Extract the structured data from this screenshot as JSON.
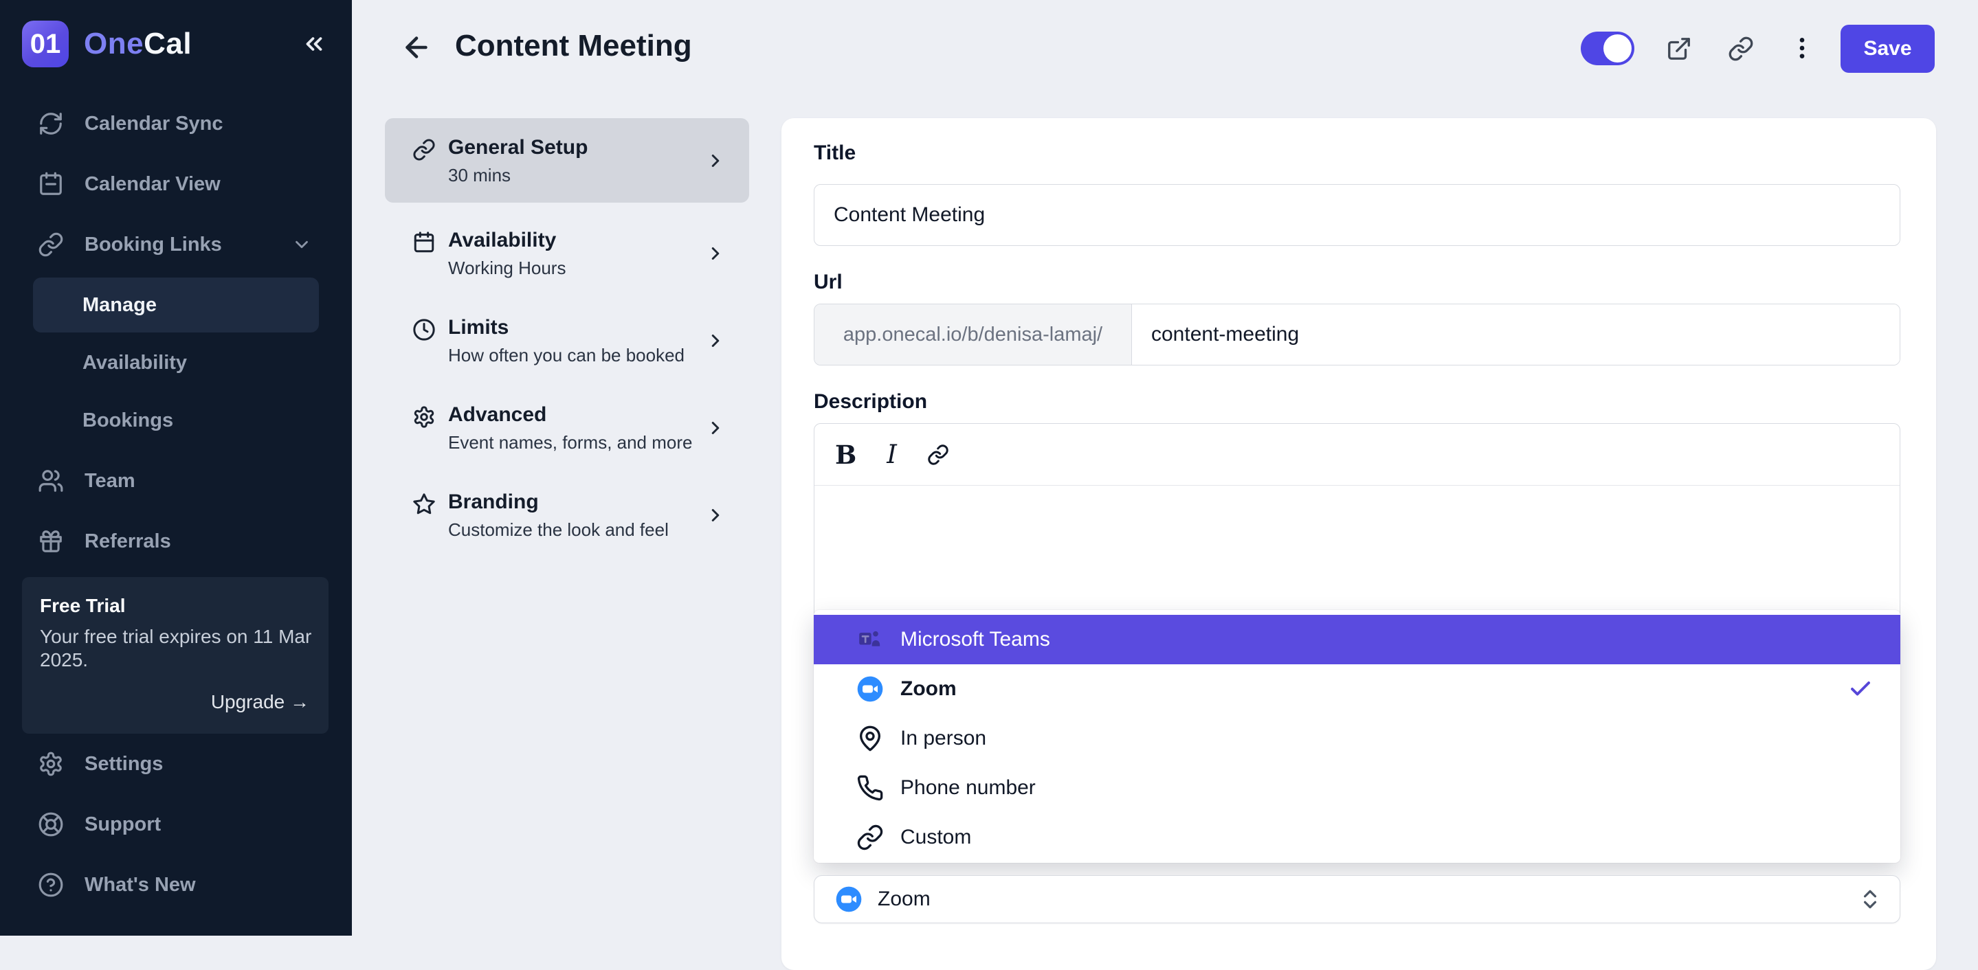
{
  "colors": {
    "accent": "#4f46e5",
    "highlight": "#5a4bdf",
    "zoom_blue": "#2d8cff",
    "sidebar_bg": "#0f1a2b"
  },
  "sidebar": {
    "brand": {
      "badge": "01",
      "name_primary": "One",
      "name_secondary": "Cal"
    },
    "items": [
      {
        "label": "Calendar Sync",
        "icon": "sync-icon"
      },
      {
        "label": "Calendar View",
        "icon": "calendar-icon"
      },
      {
        "label": "Booking Links",
        "icon": "link-icon"
      },
      {
        "label": "Team",
        "icon": "users-icon"
      },
      {
        "label": "Referrals",
        "icon": "gift-icon"
      }
    ],
    "booking_sub_items": [
      {
        "label": "Manage",
        "active": true
      },
      {
        "label": "Availability",
        "active": false
      },
      {
        "label": "Bookings",
        "active": false
      }
    ],
    "free_trial": {
      "title": "Free Trial",
      "body": "Your free trial expires on 11 Mar 2025.",
      "action_label": "Upgrade →"
    },
    "footer_items": [
      {
        "label": "Settings",
        "icon": "gear-icon"
      },
      {
        "label": "Support",
        "icon": "lifebuoy-icon"
      },
      {
        "label": "What's New",
        "icon": "help-circle-icon"
      }
    ]
  },
  "header": {
    "title": "Content Meeting",
    "save_label": "Save",
    "toggle_state": "on"
  },
  "setup_nav": [
    {
      "title": "General Setup",
      "subtitle": "30 mins",
      "icon": "link-icon",
      "active": true
    },
    {
      "title": "Availability",
      "subtitle": "Working Hours",
      "icon": "calendar-icon",
      "active": false
    },
    {
      "title": "Limits",
      "subtitle": "How often you can be booked",
      "icon": "clock-icon",
      "active": false
    },
    {
      "title": "Advanced",
      "subtitle": "Event names, forms, and more",
      "icon": "gear-icon",
      "active": false
    },
    {
      "title": "Branding",
      "subtitle": "Customize the look and feel",
      "icon": "star-icon",
      "active": false
    }
  ],
  "form": {
    "title": {
      "label": "Title",
      "value": "Content Meeting"
    },
    "url": {
      "label": "Url",
      "prefix": "app.onecal.io/b/denisa-lamaj/",
      "value": "content-meeting"
    },
    "description": {
      "label": "Description",
      "toolbar": {
        "bold": "B",
        "italic": "I"
      }
    },
    "location_dropdown": {
      "options": [
        {
          "label": "Microsoft Teams",
          "icon": "teams-icon",
          "highlighted": true,
          "selected": false
        },
        {
          "label": "Zoom",
          "icon": "zoom-icon",
          "highlighted": false,
          "selected": true
        },
        {
          "label": "In person",
          "icon": "map-pin-icon",
          "highlighted": false,
          "selected": false
        },
        {
          "label": "Phone number",
          "icon": "phone-icon",
          "highlighted": false,
          "selected": false
        },
        {
          "label": "Custom",
          "icon": "link-icon",
          "highlighted": false,
          "selected": false
        }
      ]
    },
    "location_select": {
      "value": "Zoom",
      "icon": "zoom-icon"
    }
  }
}
